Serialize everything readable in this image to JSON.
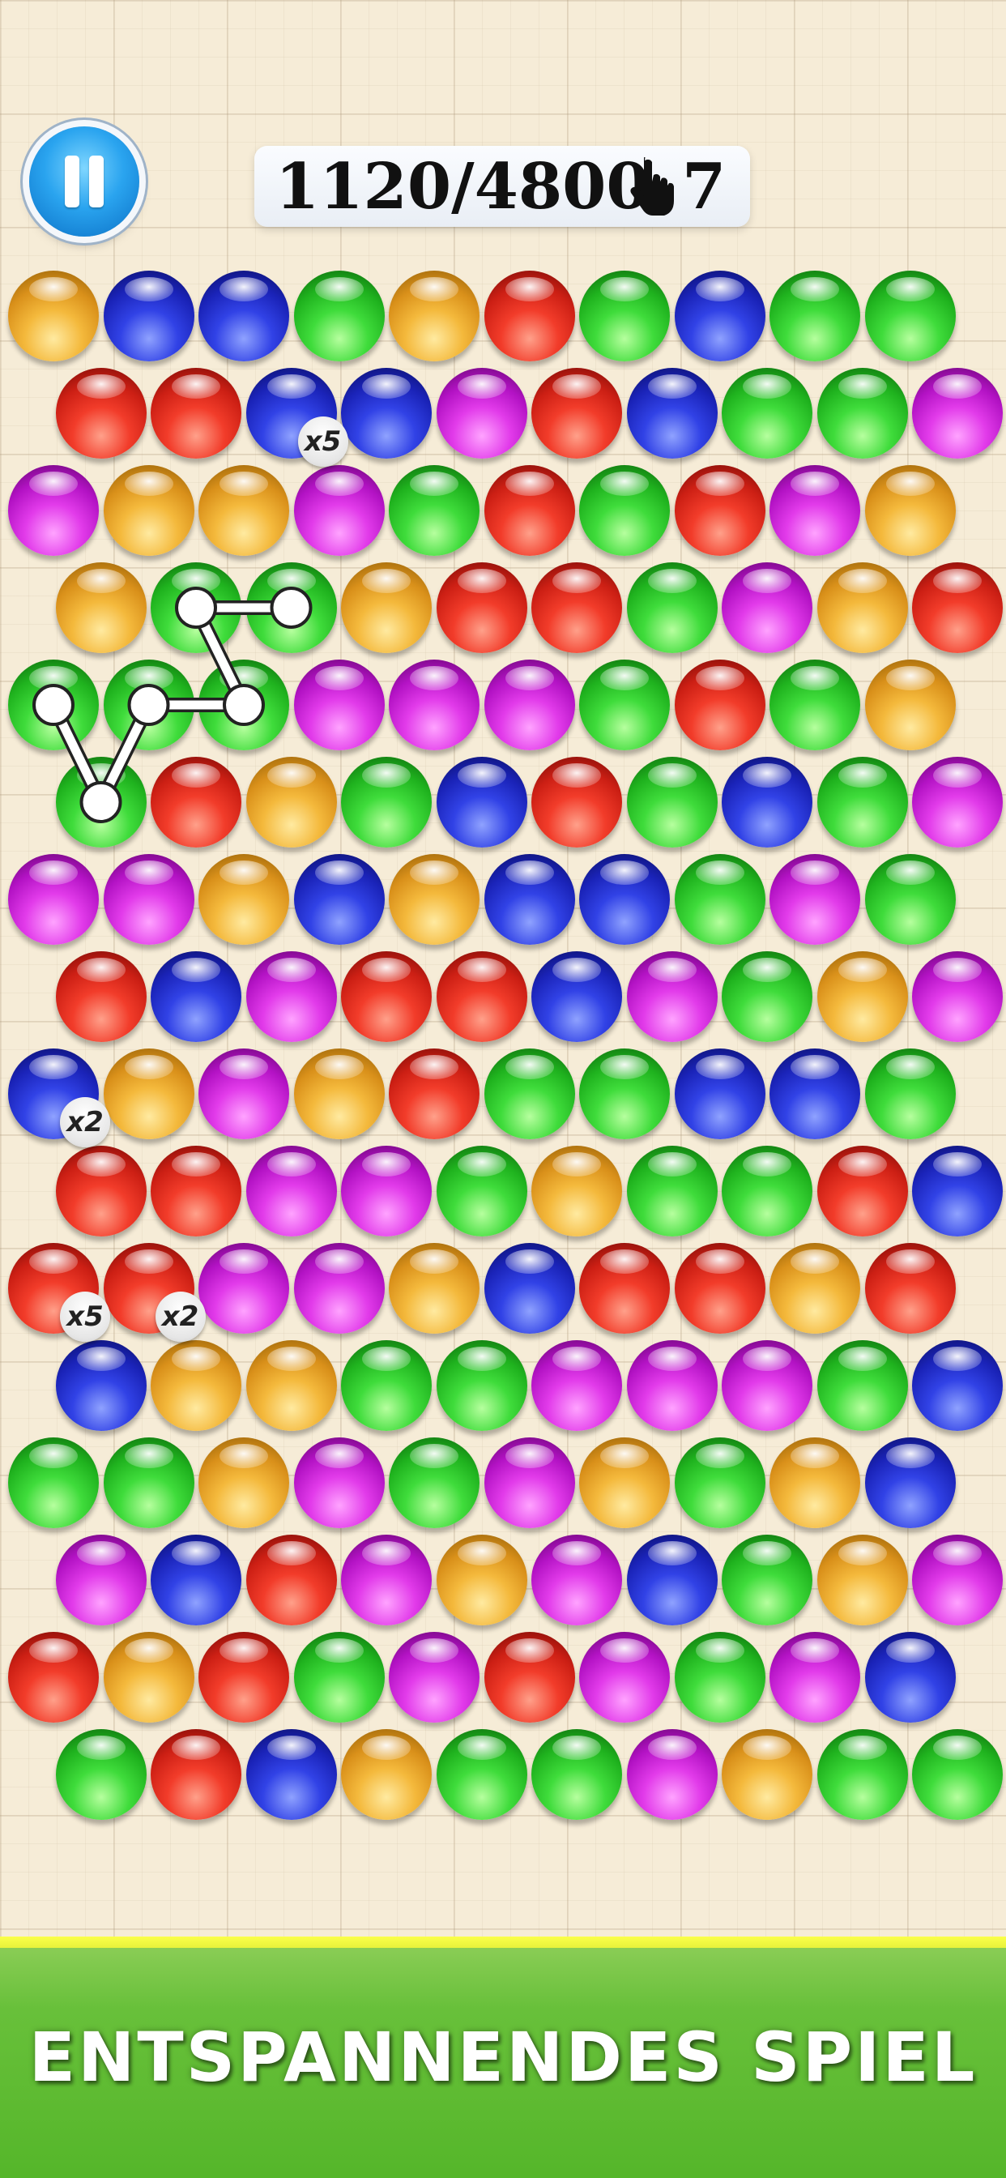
{
  "hud": {
    "score": "1120/4800",
    "moves": "7",
    "pause_icon": "pause-icon",
    "hand_icon": "hand-pointer-icon"
  },
  "colors": {
    "orange": "#f4b93c",
    "blue": "#3142e6",
    "green": "#3fdc3b",
    "red": "#f23c2a",
    "magenta": "#e23bea",
    "banner_green": "#5cb930",
    "banner_stripe": "#f4f73f"
  },
  "board": {
    "rows": [
      [
        "orange",
        "blue",
        "blue",
        "green",
        "orange",
        "red",
        "green",
        "blue",
        "green",
        "green"
      ],
      [
        "red",
        "red",
        "blue",
        "blue",
        "magenta",
        "red",
        "blue",
        "green",
        "green",
        "magenta"
      ],
      [
        "magenta",
        "orange",
        "orange",
        "magenta",
        "green",
        "red",
        "green",
        "red",
        "magenta",
        "orange"
      ],
      [
        "orange",
        "green",
        "green",
        "orange",
        "red",
        "red",
        "green",
        "magenta",
        "orange",
        "red"
      ],
      [
        "green",
        "green",
        "green",
        "magenta",
        "magenta",
        "magenta",
        "green",
        "red",
        "green",
        "orange"
      ],
      [
        "green",
        "red",
        "orange",
        "green",
        "blue",
        "red",
        "green",
        "blue",
        "green",
        "magenta"
      ],
      [
        "magenta",
        "magenta",
        "orange",
        "blue",
        "orange",
        "blue",
        "blue",
        "green",
        "magenta",
        "green"
      ],
      [
        "red",
        "blue",
        "magenta",
        "red",
        "red",
        "blue",
        "magenta",
        "green",
        "orange",
        "magenta"
      ],
      [
        "blue",
        "orange",
        "magenta",
        "orange",
        "red",
        "green",
        "green",
        "blue",
        "blue",
        "green"
      ],
      [
        "red",
        "red",
        "magenta",
        "magenta",
        "green",
        "orange",
        "green",
        "green",
        "red",
        "blue"
      ],
      [
        "red",
        "red",
        "magenta",
        "magenta",
        "orange",
        "blue",
        "red",
        "red",
        "orange",
        "red"
      ],
      [
        "blue",
        "orange",
        "orange",
        "green",
        "green",
        "magenta",
        "magenta",
        "magenta",
        "green",
        "blue"
      ],
      [
        "green",
        "green",
        "orange",
        "magenta",
        "green",
        "magenta",
        "orange",
        "green",
        "orange",
        "blue"
      ],
      [
        "magenta",
        "blue",
        "red",
        "magenta",
        "orange",
        "magenta",
        "blue",
        "green",
        "orange",
        "magenta"
      ],
      [
        "red",
        "orange",
        "red",
        "green",
        "magenta",
        "red",
        "magenta",
        "green",
        "magenta",
        "blue"
      ],
      [
        "green",
        "red",
        "blue",
        "orange",
        "green",
        "green",
        "magenta",
        "orange",
        "green",
        "green"
      ]
    ],
    "multipliers": [
      {
        "row": 1,
        "col": 2,
        "label": "x5"
      },
      {
        "row": 8,
        "col": 0,
        "label": "x2"
      },
      {
        "row": 10,
        "col": 0,
        "label": "x5"
      },
      {
        "row": 10,
        "col": 1,
        "label": "x2"
      }
    ],
    "selection_path": [
      {
        "row": 3,
        "col": 2
      },
      {
        "row": 3,
        "col": 1
      },
      {
        "row": 4,
        "col": 2
      },
      {
        "row": 4,
        "col": 1
      },
      {
        "row": 5,
        "col": 0
      },
      {
        "row": 4,
        "col": 0
      }
    ]
  },
  "banner": {
    "text": "ENTSPANNENDES SPIEL"
  }
}
